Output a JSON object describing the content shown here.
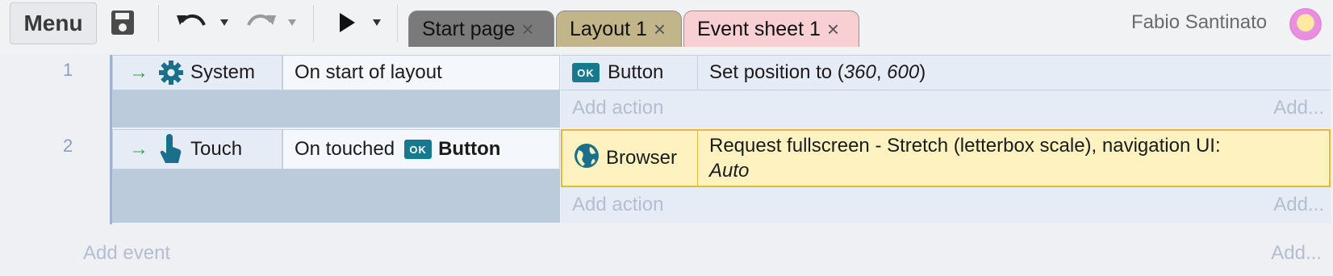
{
  "toolbar": {
    "menu_label": "Menu",
    "icons": [
      "save-icon",
      "undo-icon",
      "redo-icon",
      "play-icon"
    ]
  },
  "tabs": [
    {
      "label": "Start page"
    },
    {
      "label": "Layout 1"
    },
    {
      "label": "Event sheet 1"
    }
  ],
  "user": {
    "name": "Fabio Santinato"
  },
  "colors": {
    "accent_green": "#3aa043",
    "condition_bg": "#e6ecf5",
    "selected_action_bg": "#fdf2c0",
    "selected_action_border": "#e6b93a",
    "ok_badge": "#167a8e"
  },
  "events": [
    {
      "number": "1",
      "condition": {
        "object": "System",
        "icon": "gear-icon",
        "text": "On start of layout"
      },
      "action": {
        "object": "Button",
        "icon": "ok-button-icon",
        "text_prefix": "Set position to (",
        "param1": "360",
        "sep": ", ",
        "param2": "600",
        "text_suffix": ")"
      },
      "add_action": "Add action",
      "add_more": "Add..."
    },
    {
      "number": "2",
      "condition": {
        "object": "Touch",
        "icon": "touch-icon",
        "text": "On touched",
        "target_badge": "OK",
        "target": "Button"
      },
      "action": {
        "object": "Browser",
        "icon": "globe-icon",
        "line1": "Request fullscreen - Stretch (letterbox scale), navigation UI:",
        "line2": "Auto"
      },
      "add_action": "Add action",
      "add_more": "Add..."
    }
  ],
  "footer": {
    "add_event": "Add event",
    "add_more": "Add..."
  },
  "badge_label": "OK"
}
